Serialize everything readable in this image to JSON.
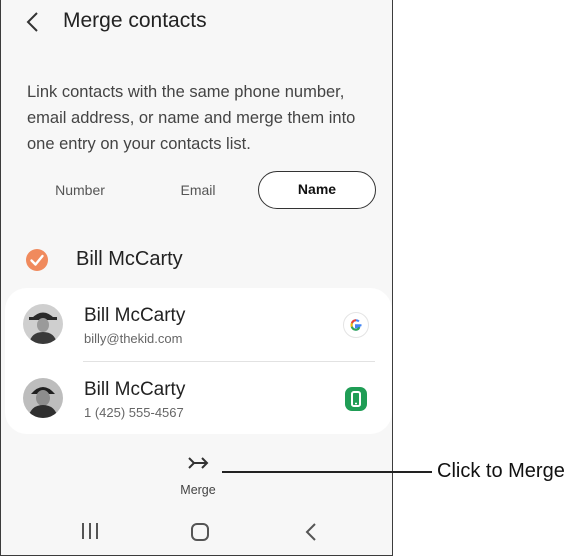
{
  "header": {
    "title": "Merge contacts",
    "back_icon": "chevron-left-icon"
  },
  "description": "Link contacts with the same phone number, email address, or name and merge them into one entry on your contacts list.",
  "tabs": [
    {
      "label": "Number",
      "selected": false
    },
    {
      "label": "Email",
      "selected": false
    },
    {
      "label": "Name",
      "selected": true
    }
  ],
  "group": {
    "name": "Bill McCarty",
    "checked": true,
    "check_color": "#f08a5d"
  },
  "contacts": [
    {
      "name": "Bill McCarty",
      "subtitle": "billy@thekid.com",
      "account_icon": "google-icon"
    },
    {
      "name": "Bill McCarty",
      "subtitle": "1 (425) 555-4567",
      "account_icon": "phone-storage-icon"
    }
  ],
  "merge": {
    "label": "Merge",
    "icon": "merge-arrows-icon"
  },
  "navbar": {
    "icons": [
      "recent-apps-icon",
      "home-icon",
      "back-icon"
    ]
  },
  "callout": {
    "text": "Click to Merge"
  },
  "colors": {
    "accent": "#f08a5d",
    "phone_green": "#1f9d55",
    "background": "#f7f7f7"
  }
}
